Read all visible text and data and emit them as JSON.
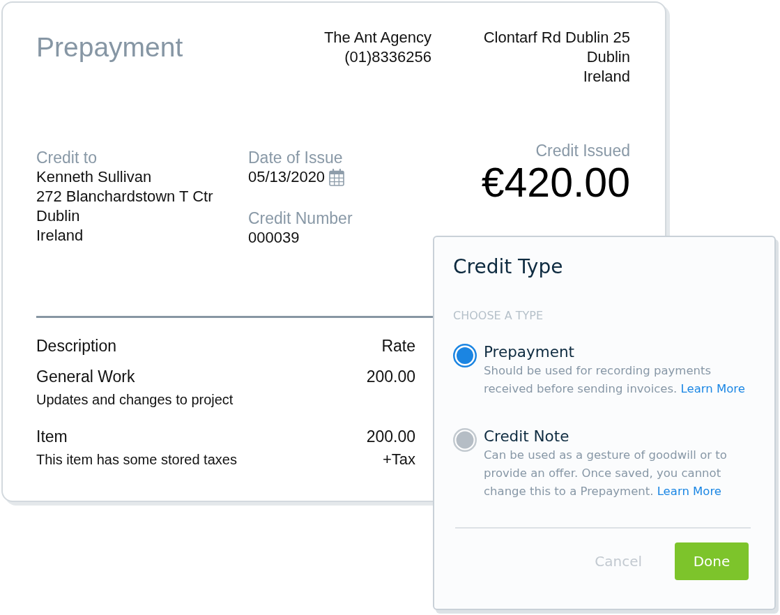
{
  "invoice": {
    "title": "Prepayment",
    "business": {
      "name": "The Ant Agency",
      "phone": "(01)8336256",
      "address": [
        "Clontarf Rd Dublin 25",
        "Dublin",
        "Ireland"
      ]
    },
    "credit_to": {
      "label": "Credit to",
      "name": "Kenneth Sullivan",
      "address": [
        "272 Blanchardstown T Ctr",
        "Dublin",
        "Ireland"
      ]
    },
    "date_of_issue": {
      "label": "Date of Issue",
      "value": "05/13/2020"
    },
    "credit_number": {
      "label": "Credit Number",
      "value": "000039"
    },
    "credit_issued": {
      "label": "Credit Issued",
      "amount": "€420.00"
    },
    "table": {
      "columns": [
        "Description",
        "Rate"
      ],
      "rows": [
        {
          "name": "General Work",
          "description": "Updates and changes to project",
          "rate": "200.00"
        },
        {
          "name": "Item",
          "description": "This item has some stored taxes",
          "rate": "200.00",
          "tax": "+Tax"
        }
      ]
    }
  },
  "dialog": {
    "title": "Credit Type",
    "section_label": "CHOOSE A TYPE",
    "options": [
      {
        "label": "Prepayment",
        "description": "Should be used for recording payments received before sending invoices.",
        "link": "Learn More",
        "selected": true
      },
      {
        "label": "Credit Note",
        "description": "Can be used as a gesture of goodwill or to provide an offer. Once saved, you cannot change this to a Prepayment.",
        "link": "Learn More",
        "selected": false
      }
    ],
    "buttons": [
      {
        "label": "Cancel",
        "kind": "secondary"
      },
      {
        "label": "Done",
        "kind": "primary"
      }
    ]
  }
}
